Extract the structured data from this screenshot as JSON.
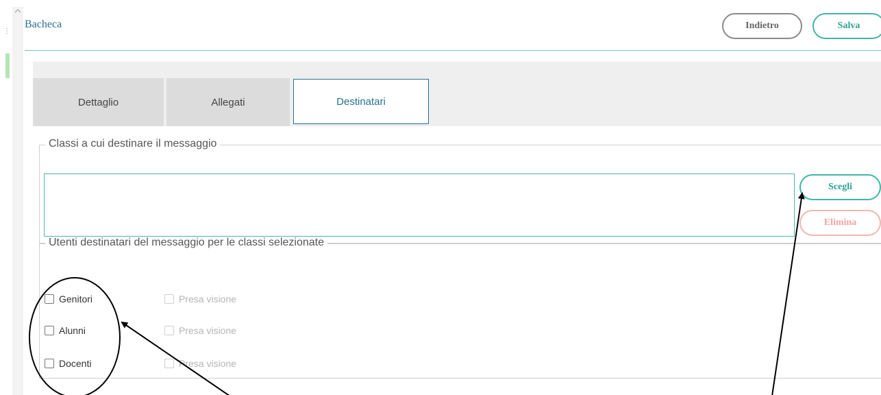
{
  "header": {
    "title": "Bacheca",
    "back_label": "Indietro",
    "save_label": "Salva"
  },
  "tabs": [
    {
      "label": "Dettaglio",
      "active": false
    },
    {
      "label": "Allegati",
      "active": false
    },
    {
      "label": "Destinatari",
      "active": true
    }
  ],
  "classi_section": {
    "legend": "Classi a cui destinare il messaggio",
    "selected_classes_value": "",
    "scegli_label": "Scegli",
    "elimina_label": "Elimina"
  },
  "utenti_section": {
    "legend": "Utenti destinatari del messaggio per le classi selezionate",
    "rows": [
      {
        "label": "Genitori",
        "checked": false,
        "presa_label": "Presa visione",
        "presa_checked": false
      },
      {
        "label": "Alunni",
        "checked": false,
        "presa_label": "Presa visione",
        "presa_checked": false
      },
      {
        "label": "Docenti",
        "checked": false,
        "presa_label": "Presa visione",
        "presa_checked": false
      }
    ]
  },
  "colors": {
    "accent_teal": "#3fb6a6",
    "title_blue": "#2a6f8f",
    "elimina_pink": "#f0a69d"
  },
  "annotations": {
    "circle": "ellipse-outline",
    "arrows": [
      "arrow-to-checkbox-group",
      "arrow-to-scegli-button"
    ]
  }
}
